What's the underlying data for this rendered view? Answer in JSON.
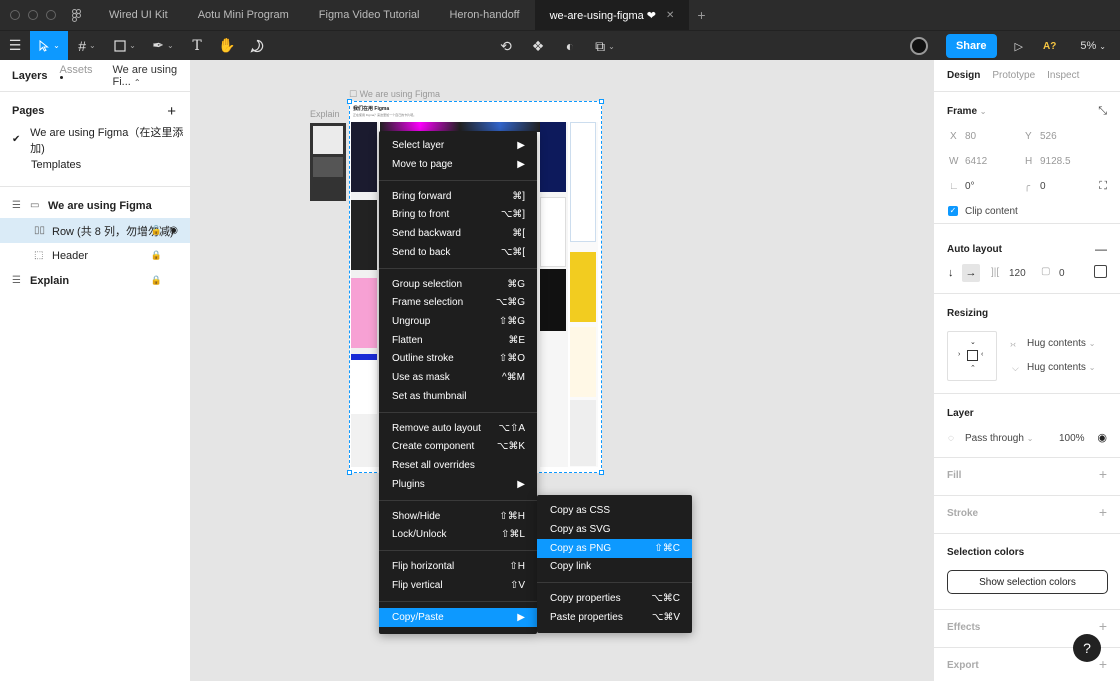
{
  "tabs": [
    {
      "label": "Wired UI Kit"
    },
    {
      "label": "Aotu Mini Program"
    },
    {
      "label": "Figma Video Tutorial"
    },
    {
      "label": "Heron-handoff"
    },
    {
      "label": "we-are-using-figma ❤",
      "close": "✕"
    }
  ],
  "toolbar": {
    "share_label": "Share",
    "a_badge": "A?",
    "zoom": "5%"
  },
  "left_panel": {
    "tab_layers": "Layers",
    "tab_assets": "Assets",
    "page_selector": "We are using Fi...",
    "pages_header": "Pages",
    "pages": [
      {
        "label": "We are using Figma（在这里添加)",
        "checked": true
      },
      {
        "label": "Templates",
        "checked": false
      }
    ],
    "layers": [
      {
        "label": "We are using Figma"
      },
      {
        "label": "Row (共 8 列，勿增勿减)"
      },
      {
        "label": "Header"
      },
      {
        "label": "Explain"
      }
    ]
  },
  "canvas": {
    "explain_label": "Explain",
    "frame_label": "We are using Figma",
    "frame_header": "我们在用 Figma",
    "frame_sub": "正在使用 Figma？来这里加一个自己的卡片吧。"
  },
  "context_menu": {
    "items": [
      {
        "label": "Select layer",
        "arrow": "▶"
      },
      {
        "label": "Move to page",
        "arrow": "▶"
      },
      {
        "label": "Bring forward",
        "shortcut": "⌘]"
      },
      {
        "label": "Bring to front",
        "shortcut": "⌥⌘]"
      },
      {
        "label": "Send backward",
        "shortcut": "⌘["
      },
      {
        "label": "Send to back",
        "shortcut": "⌥⌘["
      },
      {
        "label": "Group selection",
        "shortcut": "⌘G"
      },
      {
        "label": "Frame selection",
        "shortcut": "⌥⌘G"
      },
      {
        "label": "Ungroup",
        "shortcut": "⇧⌘G"
      },
      {
        "label": "Flatten",
        "shortcut": "⌘E"
      },
      {
        "label": "Outline stroke",
        "shortcut": "⇧⌘O"
      },
      {
        "label": "Use as mask",
        "shortcut": "^⌘M"
      },
      {
        "label": "Set as thumbnail"
      },
      {
        "label": "Remove auto layout",
        "shortcut": "⌥⇧A"
      },
      {
        "label": "Create component",
        "shortcut": "⌥⌘K"
      },
      {
        "label": "Reset all overrides"
      },
      {
        "label": "Plugins",
        "arrow": "▶"
      },
      {
        "label": "Show/Hide",
        "shortcut": "⇧⌘H"
      },
      {
        "label": "Lock/Unlock",
        "shortcut": "⇧⌘L"
      },
      {
        "label": "Flip horizontal",
        "shortcut": "⇧H"
      },
      {
        "label": "Flip vertical",
        "shortcut": "⇧V"
      },
      {
        "label": "Copy/Paste",
        "arrow": "▶"
      }
    ]
  },
  "submenu": {
    "items": [
      {
        "label": "Copy as CSS"
      },
      {
        "label": "Copy as SVG"
      },
      {
        "label": "Copy as PNG",
        "shortcut": "⇧⌘C"
      },
      {
        "label": "Copy link"
      },
      {
        "label": "Copy properties",
        "shortcut": "⌥⌘C"
      },
      {
        "label": "Paste properties",
        "shortcut": "⌥⌘V"
      }
    ]
  },
  "right_panel": {
    "tab_design": "Design",
    "tab_prototype": "Prototype",
    "tab_inspect": "Inspect",
    "frame_title": "Frame",
    "x_label": "X",
    "x_value": "80",
    "y_label": "Y",
    "y_value": "526",
    "w_label": "W",
    "w_value": "6412",
    "h_label": "H",
    "h_value": "9128.5",
    "rotation": "0°",
    "radius": "0",
    "clip_content": "Clip content",
    "auto_layout_title": "Auto layout",
    "spacing": "120",
    "padding": "0",
    "resizing_title": "Resizing",
    "hug_h": "Hug contents",
    "hug_v": "Hug contents",
    "layer_title": "Layer",
    "blend_mode": "Pass through",
    "opacity": "100%",
    "fill_title": "Fill",
    "stroke_title": "Stroke",
    "selection_colors_title": "Selection colors",
    "show_selection_colors": "Show selection colors",
    "effects_title": "Effects",
    "export_title": "Export",
    "help": "?"
  }
}
